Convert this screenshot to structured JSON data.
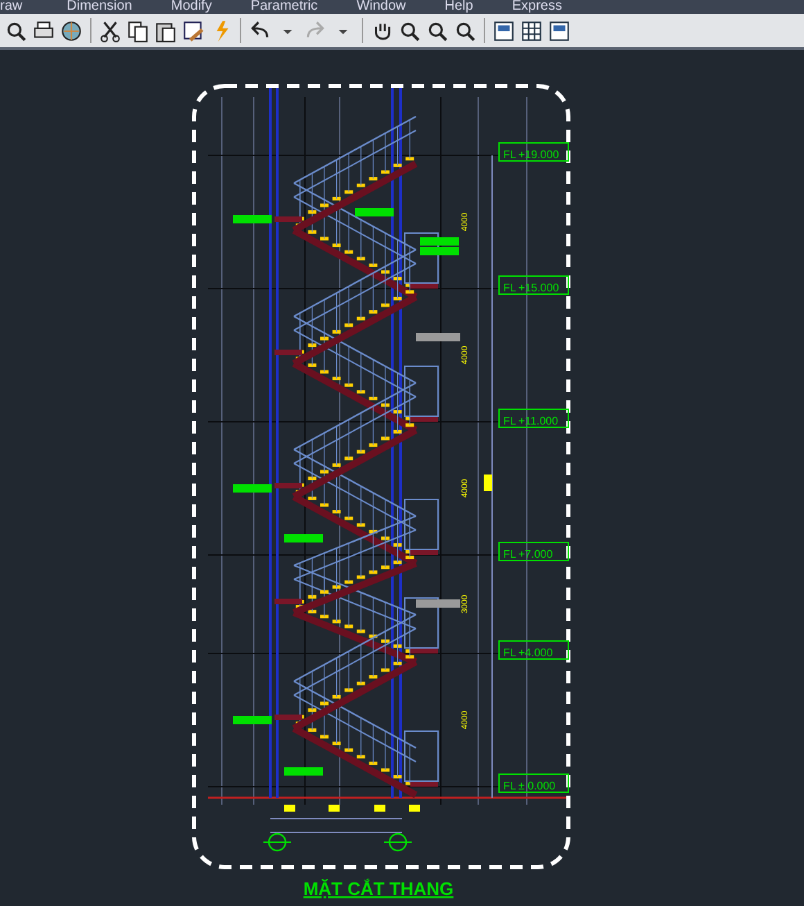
{
  "menu": [
    "raw",
    "Dimension",
    "Modify",
    "Parametric",
    "Window",
    "Help",
    "Express"
  ],
  "levels": [
    {
      "prefix": "FL",
      "value": "+19.000"
    },
    {
      "prefix": "FL",
      "value": "+15.000"
    },
    {
      "prefix": "FL",
      "value": "+11.000"
    },
    {
      "prefix": "FL",
      "value": "+7.000"
    },
    {
      "prefix": "FL",
      "value": "+4.000"
    },
    {
      "prefix": "FL",
      "value": "± 0.000"
    }
  ],
  "heights": [
    "4000",
    "4000",
    "4000",
    "3000",
    "4000"
  ],
  "title": "MẶT CẮT THANG"
}
